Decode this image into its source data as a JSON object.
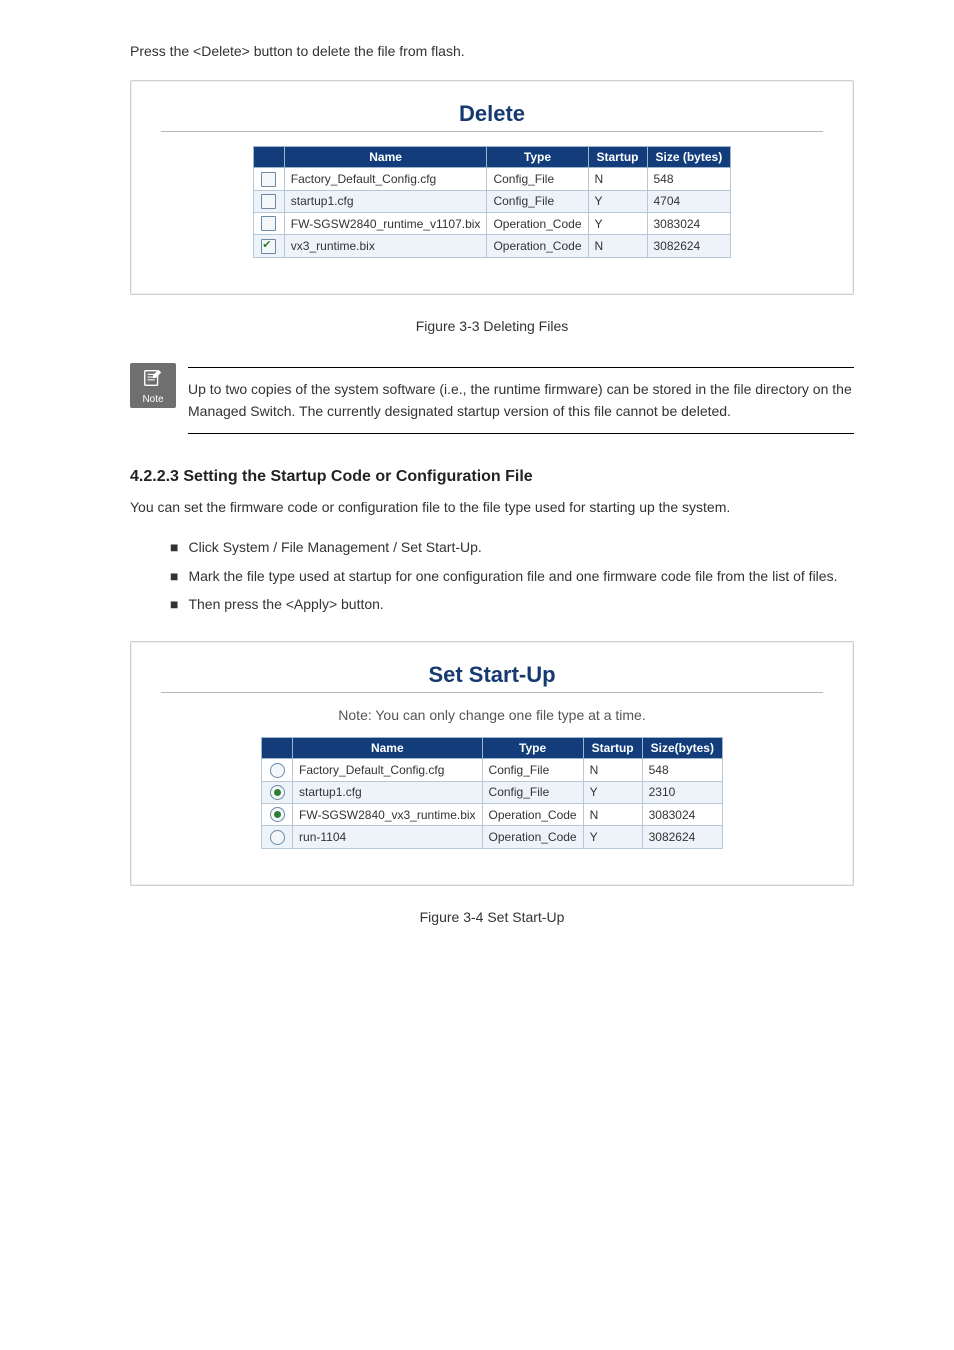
{
  "intro_text": "Press the <Delete> button to delete the file from flash.",
  "delete_panel": {
    "title": "Delete",
    "columns": [
      "",
      "Name",
      "Type",
      "Startup",
      "Size (bytes)"
    ],
    "rows": [
      {
        "checked": false,
        "name": "Factory_Default_Config.cfg",
        "type": "Config_File",
        "startup": "N",
        "size": "548"
      },
      {
        "checked": false,
        "name": "startup1.cfg",
        "type": "Config_File",
        "startup": "Y",
        "size": "4704"
      },
      {
        "checked": false,
        "name": "FW-SGSW2840_runtime_v1107.bix",
        "type": "Operation_Code",
        "startup": "Y",
        "size": "3083024"
      },
      {
        "checked": true,
        "name": "vx3_runtime.bix",
        "type": "Operation_Code",
        "startup": "N",
        "size": "3082624"
      }
    ]
  },
  "figure3_caption": "Figure 3-3 Deleting Files",
  "note": {
    "icon_text": "Note",
    "body": "Up to two copies of the system software (i.e., the runtime firmware) can be stored in the file directory on the Managed Switch. The currently designated startup version of this file cannot be deleted."
  },
  "setstart_heading": "4.2.2.3 Setting the Startup Code or Configuration File",
  "setstart_text": "You can set the firmware code or configuration file to the file type used for starting up the system.",
  "bullets": [
    "Click System / File Management / Set Start-Up.",
    "Mark the file type used at startup for one configuration file and one firmware code file from the list of files.",
    "Then press the <Apply> button."
  ],
  "startup_panel": {
    "title": "Set Start-Up",
    "note_line": "Note: You can only change one file type at a time.",
    "columns": [
      "",
      "Name",
      "Type",
      "Startup",
      "Size(bytes)"
    ],
    "rows": [
      {
        "selected": false,
        "name": "Factory_Default_Config.cfg",
        "type": "Config_File",
        "startup": "N",
        "size": "548"
      },
      {
        "selected": true,
        "name": "startup1.cfg",
        "type": "Config_File",
        "startup": "Y",
        "size": "2310"
      },
      {
        "selected": true,
        "name": "FW-SGSW2840_vx3_runtime.bix",
        "type": "Operation_Code",
        "startup": "N",
        "size": "3083024"
      },
      {
        "selected": false,
        "name": "run-1104",
        "type": "Operation_Code",
        "startup": "Y",
        "size": "3082624"
      }
    ]
  },
  "figure4_caption": "Figure 3-4 Set Start-Up"
}
